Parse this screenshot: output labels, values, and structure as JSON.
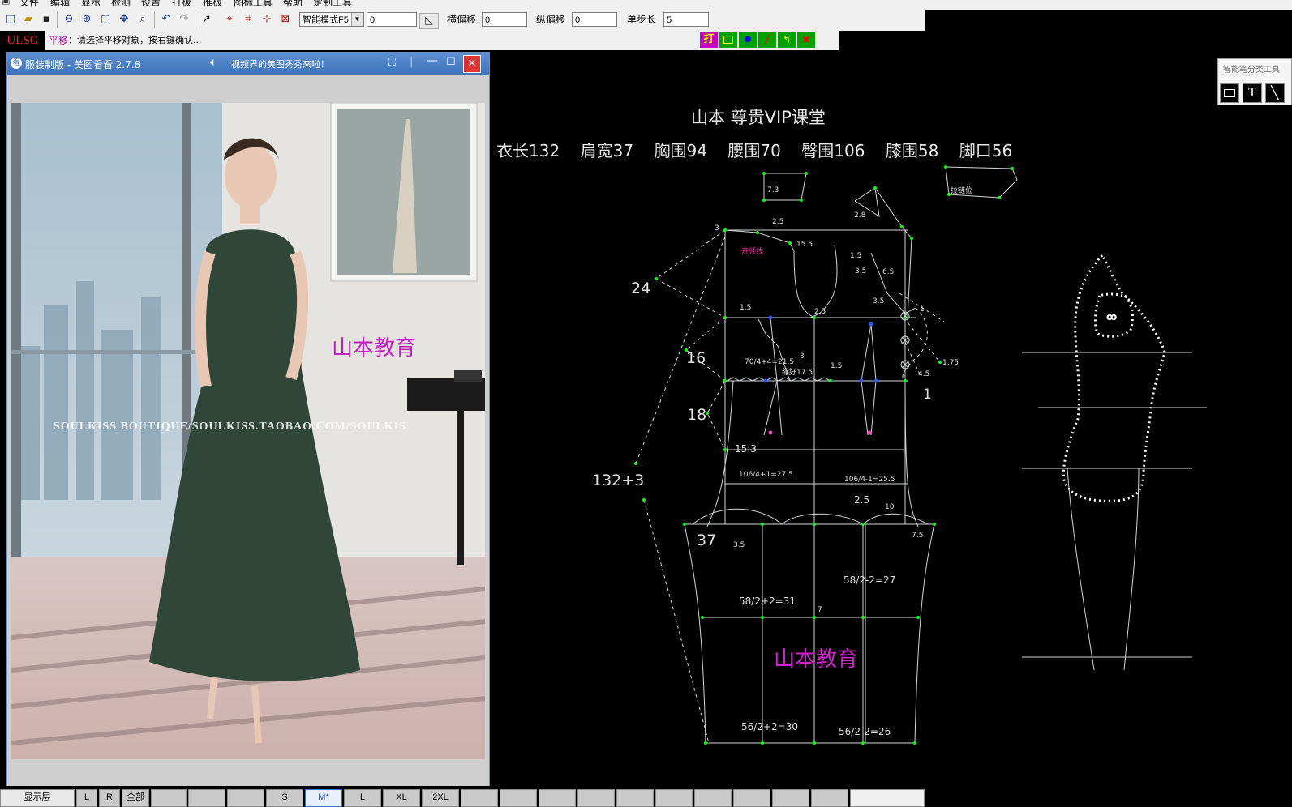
{
  "menu": [
    "文件",
    "编辑",
    "显示",
    "检测",
    "设置",
    "打板",
    "推板",
    "图标工具",
    "帮助",
    "定制工具"
  ],
  "toolbar": {
    "mode_select": "智能模式F5",
    "mode_value": "0",
    "h_offset_label": "横偏移",
    "h_offset_value": "0",
    "v_offset_label": "纵偏移",
    "v_offset_value": "0",
    "step_label": "单步长",
    "step_value": "5"
  },
  "status": {
    "logo": "ULSG",
    "mode": "平移",
    "message": "：请选择平移对象，按右键确认..."
  },
  "viewer": {
    "title": "服装制版 - 美图看看 2.7.8",
    "promo": "视频界的美图秀秀来啦！",
    "watermark": "山本教育",
    "store_url": "SOULKISS BOUTIQUE/SOULKISS.TAOBAO.COM/SOULKIS"
  },
  "cad": {
    "header": "山本   尊贵VIP课堂",
    "measurements": "衣长132    肩宽37    胸围94    腰围70    臀围106    膝围58    脚口56",
    "watermark": "山本教育",
    "labels": {
      "l24": "24",
      "l16": "16",
      "l18": "18",
      "l1323": "132+3",
      "l37": "37",
      "l73": "7.3",
      "zipper": "拉链位",
      "l25a": "2.5",
      "l155": "15.5",
      "l15a": "1.5",
      "l25b": "2.5",
      "l28": "2.8",
      "l15b": "1.5",
      "l35a": "3.5",
      "l65": "6.5",
      "l35b": "3.5",
      "l1a": "1",
      "bust": "70/4+4=21.5",
      "waist": "缩好17.5",
      "l3": "3",
      "l15c": "1.5",
      "l175": "1.75",
      "l45": "4.5",
      "l1b": "1",
      "l153": "15:3",
      "hipf": "106/4+1=27.5",
      "hipb": "106/4-1=25.5",
      "l25c": "2.5",
      "l10": "10",
      "l35c": "3.5",
      "l75": "7.5",
      "kneeb": "58/2-2=27",
      "kneef": "58/2+2=31",
      "l7": "7",
      "hemf": "56/2+2=30",
      "hemb": "56/2-2=26",
      "neckline": "开领线",
      "l4": "3"
    }
  },
  "toolpanel": {
    "title": "智能笔分类工具"
  },
  "bottom_tabs": [
    "显示层",
    "L",
    "R",
    "全部",
    "",
    "",
    "",
    "S",
    "M*",
    "L",
    "XL",
    "2XL",
    "",
    "",
    "",
    "",
    "",
    "",
    "",
    "",
    "",
    ""
  ]
}
